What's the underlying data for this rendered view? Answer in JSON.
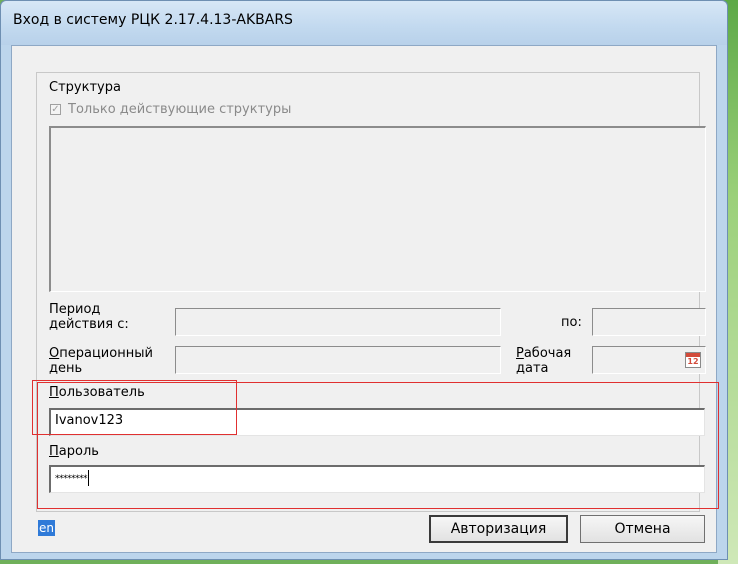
{
  "window": {
    "title": "Вход в систему РЦК 2.17.4.13-AKBARS"
  },
  "structure": {
    "label": "Структура",
    "checkbox_label": "Только действующие структуры",
    "checkbox_checked": true
  },
  "period": {
    "from_label_line1": "Период",
    "from_label_line2": "действия с:",
    "to_label": "по:"
  },
  "operational_day": {
    "label_line1_rest": "перационный",
    "label_line1_key": "О",
    "label_line2": "день"
  },
  "work_date": {
    "label_line1_key": "Р",
    "label_line1_rest": "абочая",
    "label_line2": "дата",
    "icon_number": "12"
  },
  "user": {
    "label_key": "П",
    "label_rest": "ользователь",
    "value": "Ivanov123"
  },
  "password": {
    "label_key": "П",
    "label_rest": "ароль",
    "value": "********"
  },
  "footer": {
    "lang": "en",
    "auth_button": "Авторизация",
    "cancel_button": "Отмена"
  },
  "colors": {
    "annotation": "#e03030",
    "window_frame": "#bcd5ec",
    "desktop": "#6fb05a"
  }
}
